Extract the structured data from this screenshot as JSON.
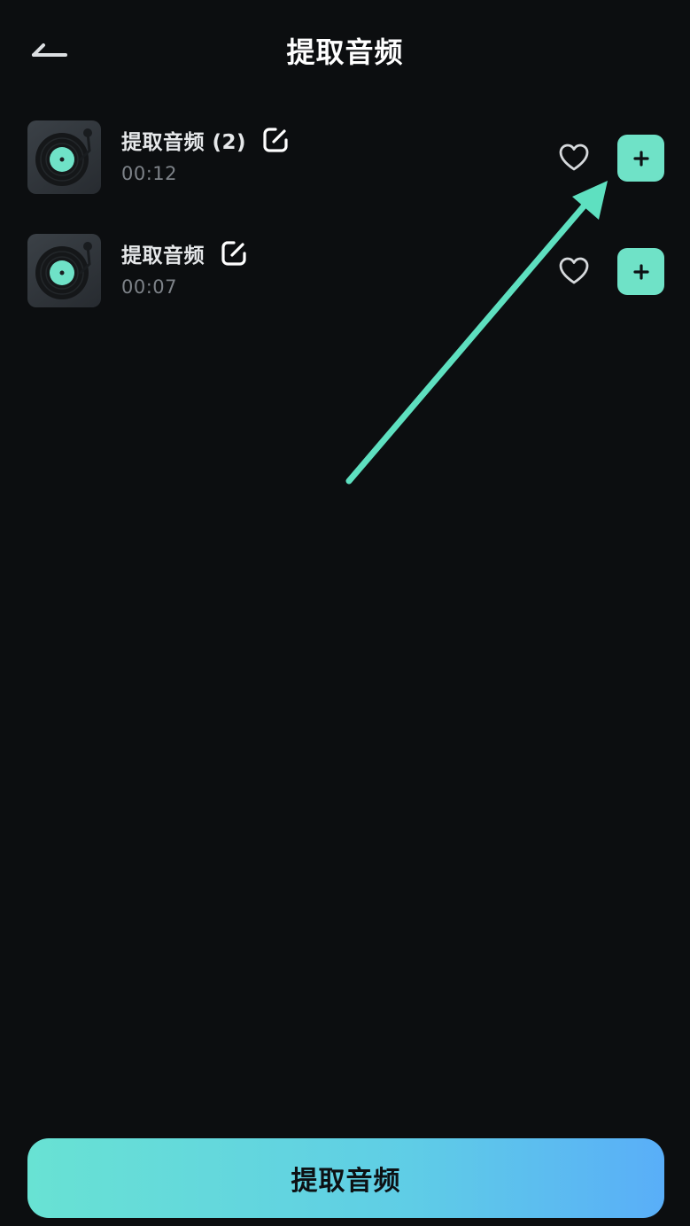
{
  "header": {
    "title": "提取音频",
    "back_icon": "back-arrow-icon"
  },
  "audio_items": [
    {
      "title": "提取音频 (2)",
      "duration": "00:12",
      "thumbnail_icon": "vinyl-record-icon",
      "rename_icon": "edit-icon",
      "favorite_icon": "heart-outline-icon",
      "add_label": "+"
    },
    {
      "title": "提取音频",
      "duration": "00:07",
      "thumbnail_icon": "vinyl-record-icon",
      "rename_icon": "edit-icon",
      "favorite_icon": "heart-outline-icon",
      "add_label": "+"
    }
  ],
  "footer": {
    "extract_button_label": "提取音频"
  },
  "colors": {
    "background": "#0c0e10",
    "accent": "#6fe2c7",
    "arrow": "#5ee0c0",
    "button_gradient_start": "#68e2d3",
    "button_gradient_end": "#59aef8"
  }
}
